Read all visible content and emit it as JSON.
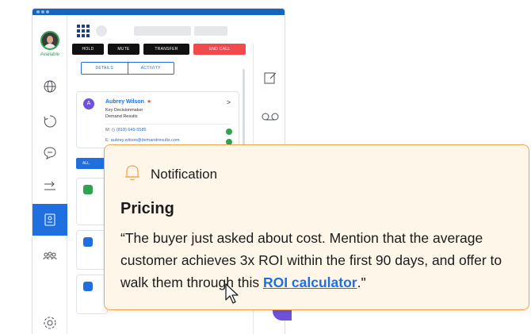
{
  "agent": {
    "status": "Available"
  },
  "call_controls": {
    "hold": "HOLD",
    "mute": "MUTE",
    "transfer": "TRANSFER",
    "end_call": "END CALL"
  },
  "tabs": {
    "details": "DETAILS",
    "activity": "ACTIVITY"
  },
  "contact": {
    "initial": "A",
    "name": "Aubrey Wilson",
    "role": "Key Decisionmaker",
    "company": "Demand Results",
    "phone_label": "M:",
    "phone": "(818) 649-5585",
    "email_label": "E:",
    "email": "aubrey.wilson@demandresults.com"
  },
  "filter": {
    "all": "ALL"
  },
  "notification": {
    "label": "Notification",
    "heading": "Pricing",
    "body_before": "“The buyer just asked about cost. Mention that the average customer achieves 3x ROI within the first 90 days, and offer to walk them through this ",
    "link_text": "ROI calculator",
    "body_after": ".\""
  },
  "icons": {
    "nav": [
      "globe-icon",
      "refresh-icon",
      "chat-icon",
      "transfer-icon",
      "contact-card-icon",
      "team-icon",
      "settings-icon"
    ],
    "rail": [
      "compose-icon",
      "voicemail-icon",
      "tag-icon"
    ]
  },
  "colors": {
    "accent": "#1f6fe0",
    "end_call": "#f2494d",
    "notification_border": "#f0a651",
    "notification_bg": "#fff6ea",
    "available": "#2ea44f"
  }
}
